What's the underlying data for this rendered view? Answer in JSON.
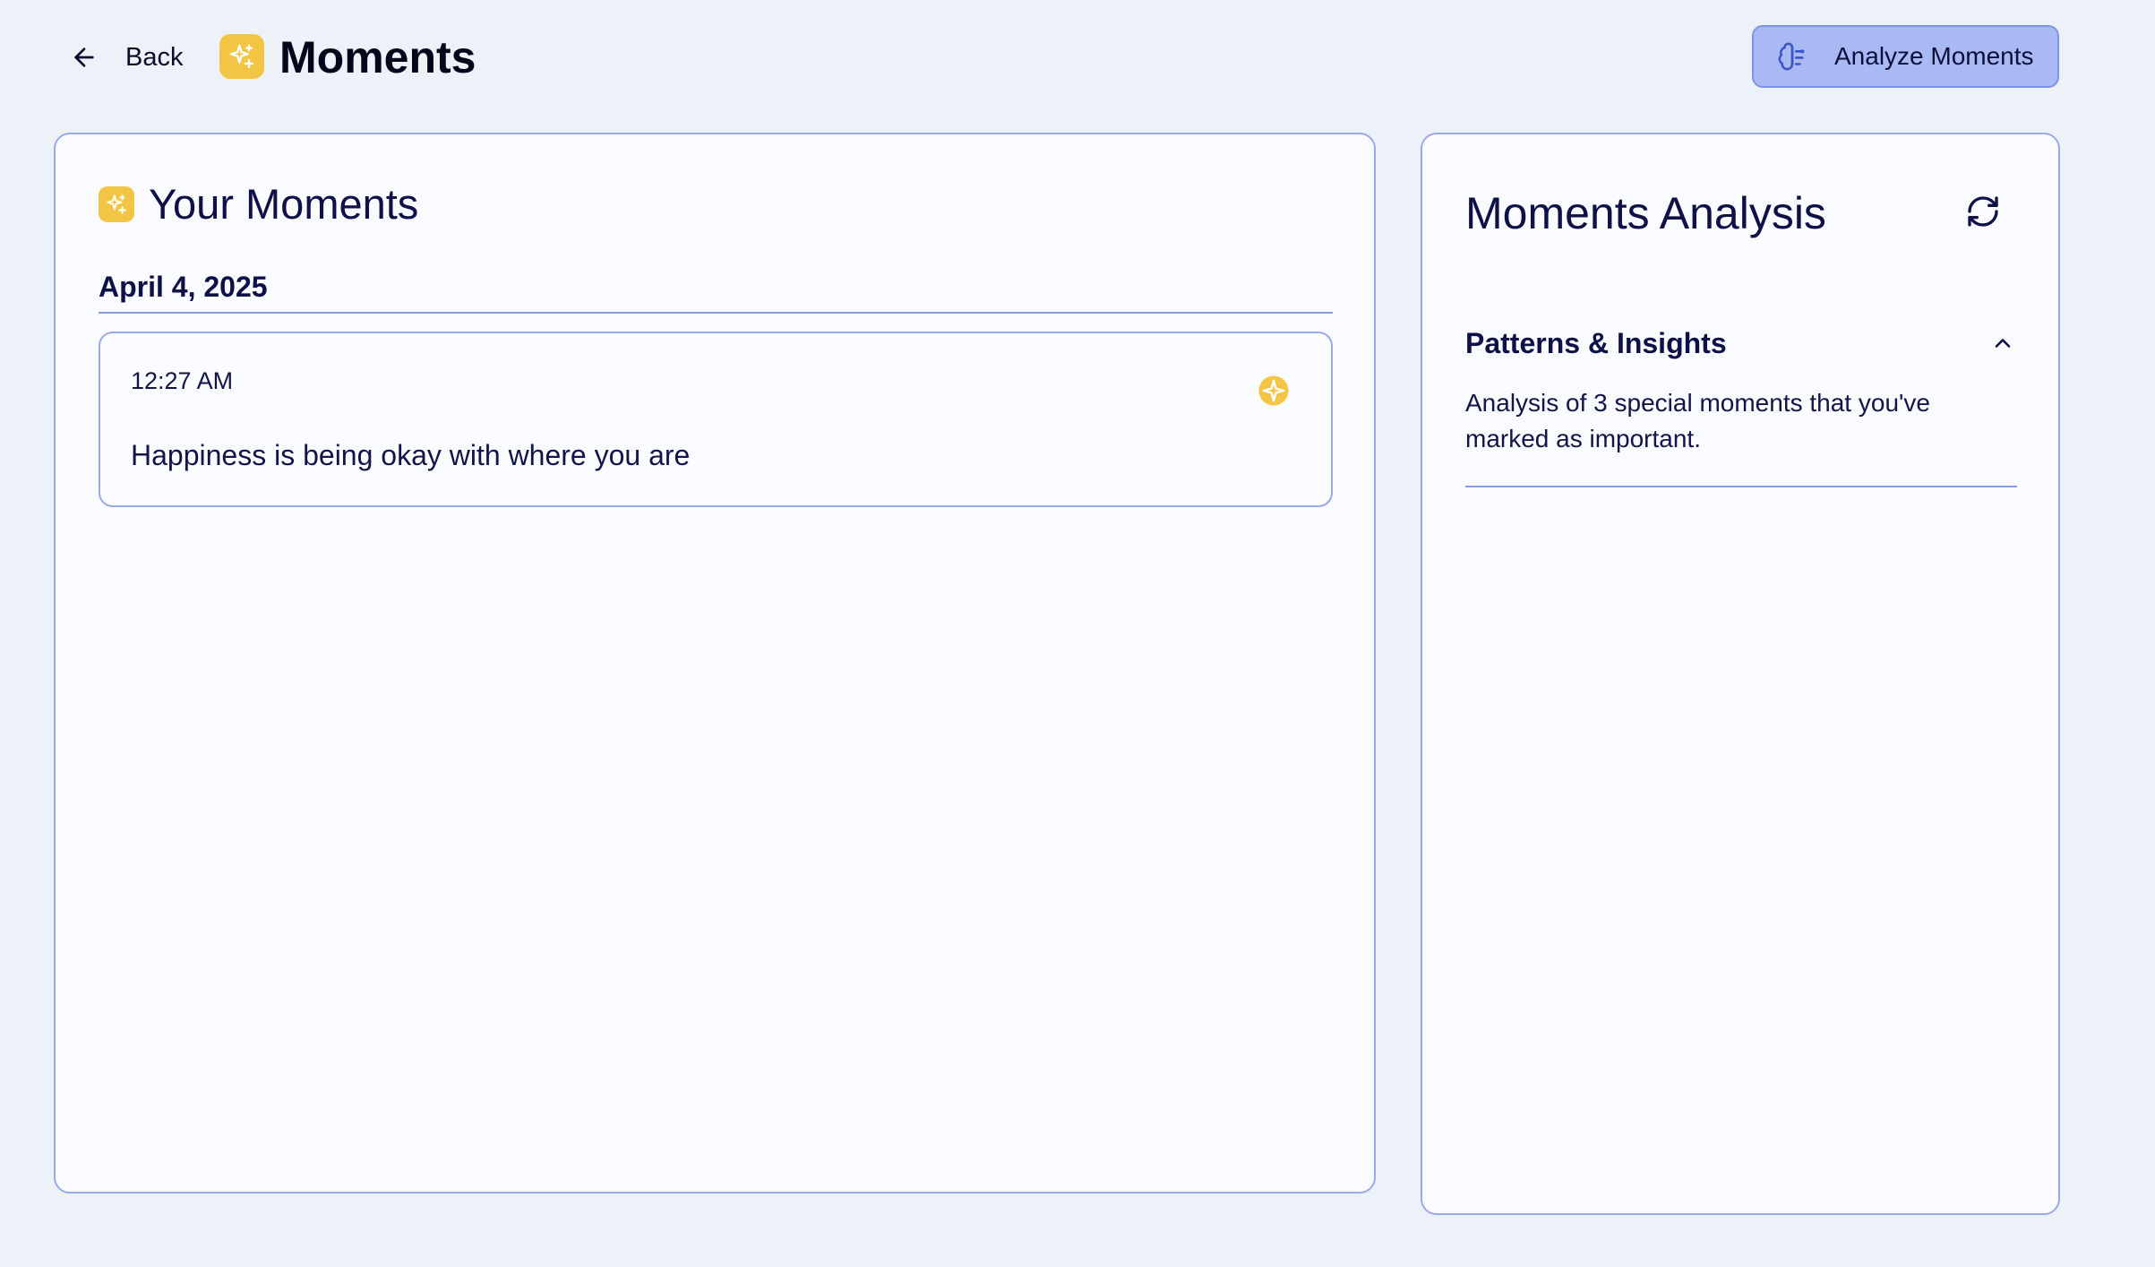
{
  "header": {
    "back_label": "Back",
    "title": "Moments",
    "analyze_label": "Analyze Moments"
  },
  "moments": {
    "title": "Your Moments",
    "groups": [
      {
        "date": "April 4, 2025",
        "entries": [
          {
            "time": "12:27 AM",
            "text": "Happiness is being okay with where you are"
          }
        ]
      }
    ]
  },
  "analysis": {
    "title": "Moments Analysis",
    "section": {
      "title": "Patterns & Insights",
      "body": "Analysis of 3 special moments that you've marked as important."
    }
  },
  "colors": {
    "background": "#edf1f8",
    "accent_yellow": "#f2c544",
    "button_fill": "#a9b9f4",
    "border": "#9aaae6",
    "text_dark": "#12154a"
  },
  "icons": {
    "back": "arrow-left-icon",
    "logo": "sparkles-icon",
    "analyze": "brain-icon",
    "refresh": "refresh-icon",
    "collapse": "chevron-up-icon",
    "entry_marker": "star-badge-icon"
  }
}
